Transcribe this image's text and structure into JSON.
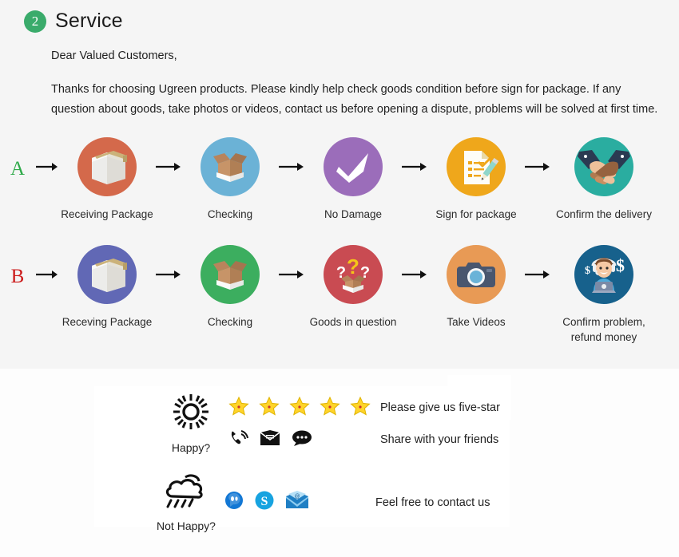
{
  "header": {
    "badge_number": "2",
    "title": "Service",
    "badge_color": "#3aab6b"
  },
  "intro": {
    "greeting": "Dear Valued Customers,",
    "paragraph": "Thanks for choosing Ugreen products. Please kindly help check goods condition before sign for package. If any question about goods, take photos or videos, contact us before opening a dispute, problems will be solved at first time."
  },
  "flows": [
    {
      "tag": "A",
      "tag_color": "#2faa4a",
      "steps": [
        {
          "label": "Receiving Package",
          "icon": "sealed-box-icon",
          "circle_color": "#d4694b"
        },
        {
          "label": "Checking",
          "icon": "open-box-icon",
          "circle_color": "#6bb2d6"
        },
        {
          "label": "No Damage",
          "icon": "checkmark-icon",
          "circle_color": "#9b6dba"
        },
        {
          "label": "Sign for package",
          "icon": "sign-document-icon",
          "circle_color": "#efa71b"
        },
        {
          "label": "Confirm the delivery",
          "icon": "handshake-icon",
          "circle_color": "#2aada0"
        }
      ]
    },
    {
      "tag": "B",
      "tag_color": "#cc1b1b",
      "steps": [
        {
          "label": "Receving Package",
          "icon": "sealed-box-icon",
          "circle_color": "#6168b5"
        },
        {
          "label": "Checking",
          "icon": "open-box-icon",
          "circle_color": "#3cae5f"
        },
        {
          "label": "Goods in question",
          "icon": "question-box-icon",
          "circle_color": "#c94b52"
        },
        {
          "label": "Take Videos",
          "icon": "camera-icon",
          "circle_color": "#e89a55"
        },
        {
          "label": "Confirm problem,\nrefund money",
          "icon": "support-agent-icon",
          "circle_color": "#17618c"
        }
      ]
    }
  ],
  "feedback": {
    "happy": {
      "mood_icon": "sun-icon",
      "mood_label": "Happy?",
      "lines": [
        {
          "icons": [
            "star-icon",
            "star-icon",
            "star-icon",
            "star-icon",
            "star-icon"
          ],
          "text": "Please give us five-star"
        },
        {
          "icons": [
            "phone-ringing-icon",
            "envelope-icon",
            "chat-bubble-icon"
          ],
          "text": "Share with your friends"
        }
      ]
    },
    "not_happy": {
      "mood_icon": "rain-cloud-icon",
      "mood_label": "Not Happy?",
      "lines": [
        {
          "icons": [
            "messenger-icon",
            "skype-icon",
            "email-at-icon"
          ],
          "text": "Feel free to contact us"
        }
      ]
    },
    "star_color": "#ffd42a"
  }
}
